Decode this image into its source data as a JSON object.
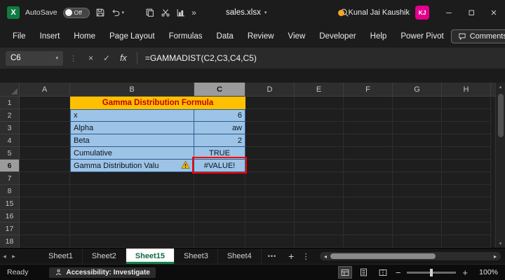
{
  "titlebar": {
    "autosave_label": "AutoSave",
    "autosave_state": "Off",
    "filename": "sales.xlsx",
    "user_name": "Kunal Jai Kaushik",
    "user_initials": "KJ"
  },
  "ribbon": {
    "tabs": [
      "File",
      "Insert",
      "Home",
      "Page Layout",
      "Formulas",
      "Data",
      "Review",
      "View",
      "Developer",
      "Help",
      "Power Pivot"
    ],
    "comments_label": "Comments"
  },
  "formula_bar": {
    "name_box": "C6",
    "fx_label": "fx",
    "formula": "=GAMMADIST(C2,C3,C4,C5)"
  },
  "sheet": {
    "columns": [
      "A",
      "B",
      "C",
      "D",
      "E",
      "F",
      "G",
      "H"
    ],
    "rows": [
      "1",
      "2",
      "3",
      "4",
      "5",
      "6",
      "7",
      "8",
      "15",
      "16",
      "17",
      "18"
    ],
    "selected_cell": "C6",
    "title_cell": "Gamma Distribution Formula",
    "data": [
      {
        "row": "2",
        "label": "x",
        "value": "6"
      },
      {
        "row": "3",
        "label": "Alpha",
        "value": "aw"
      },
      {
        "row": "4",
        "label": "Beta",
        "value": "2"
      },
      {
        "row": "5",
        "label": "Cumulative",
        "value": "TRUE"
      },
      {
        "row": "6",
        "label": "Gamma Distribution Valu",
        "value": "#VALUE!"
      }
    ]
  },
  "tabs_bar": {
    "sheet_tabs": [
      "Sheet1",
      "Sheet2",
      "Sheet15",
      "Sheet3",
      "Sheet4"
    ],
    "active_tab": "Sheet15"
  },
  "status_bar": {
    "mode": "Ready",
    "accessibility": "Accessibility: Investigate",
    "zoom": "100%"
  },
  "colors": {
    "excel_green": "#107C41",
    "title_fill": "#FFC000",
    "title_text": "#C00000",
    "range_fill": "#9DC3E6",
    "error_border": "#FF0000",
    "avatar": "#E3008C",
    "active_tab_green": "#13814A"
  },
  "icons": {
    "excel_logo": "X",
    "caret_down": "▾",
    "triangle_up": "▴",
    "triangle_down": "▾",
    "triangle_left": "◂",
    "triangle_right": "▸",
    "ellipsis_vertical": "⋮",
    "check": "✓",
    "close": "×",
    "chevron_double": "»",
    "more_dots": "•••",
    "plus": "+",
    "minus": "−"
  }
}
